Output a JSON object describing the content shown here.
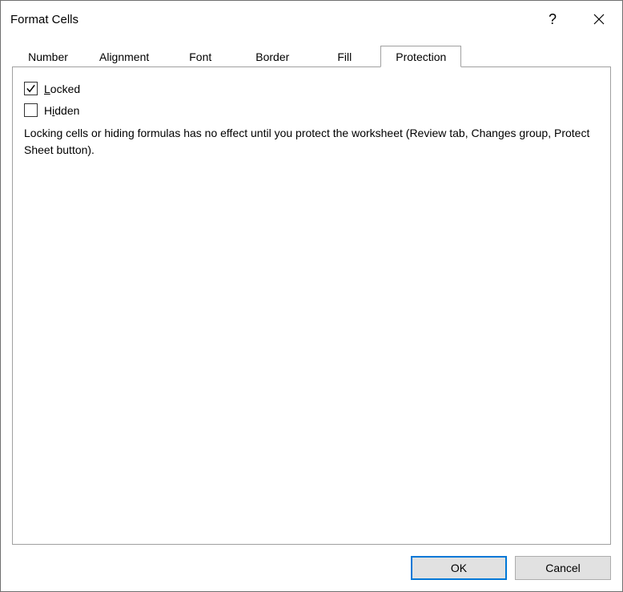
{
  "titlebar": {
    "title": "Format Cells",
    "help_tooltip": "?"
  },
  "tabs": {
    "items": [
      {
        "label": "Number"
      },
      {
        "label": "Alignment"
      },
      {
        "label": "Font"
      },
      {
        "label": "Border"
      },
      {
        "label": "Fill"
      },
      {
        "label": "Protection"
      }
    ],
    "active_index": 5
  },
  "protection_panel": {
    "locked_label": "Locked",
    "locked_checked": true,
    "hidden_label": "Hidden",
    "hidden_checked": false,
    "info_text": "Locking cells or hiding formulas has no effect until you protect the worksheet (Review tab, Changes group, Protect Sheet button)."
  },
  "buttons": {
    "ok": "OK",
    "cancel": "Cancel"
  }
}
